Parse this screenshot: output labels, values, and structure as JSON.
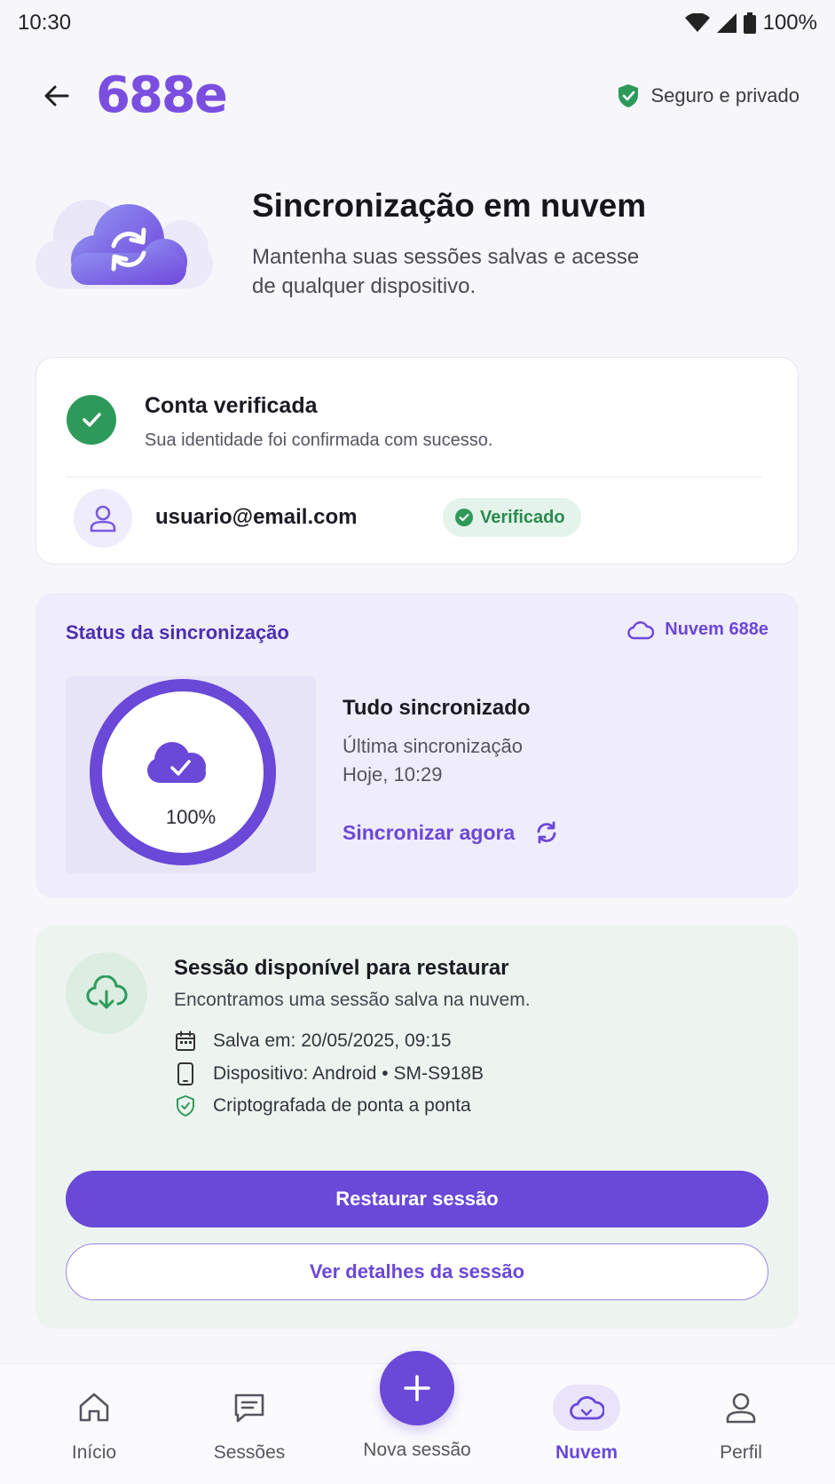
{
  "status_bar": {
    "time": "10:30",
    "battery": "100%"
  },
  "header": {
    "logo": "688e",
    "secure_label": "Seguro e privado"
  },
  "hero": {
    "title": "Sincronização em nuvem",
    "subtitle": "Mantenha suas sessões salvas e acesse de qualquer dispositivo."
  },
  "account": {
    "title": "Conta verificada",
    "subtitle": "Sua identidade foi confirmada com sucesso.",
    "email": "usuario@email.com",
    "badge": "Verificado"
  },
  "sync": {
    "section_label": "Status da sincronização",
    "cloud_label": "Nuvem 688e",
    "progress_percent": 100,
    "progress_label": "100%",
    "state": "Tudo sincronizado",
    "last_sync_label": "Última sincronização",
    "last_sync_time": "Hoje, 10:29",
    "sync_now_label": "Sincronizar agora"
  },
  "restore": {
    "title": "Sessão disponível para restaurar",
    "subtitle": "Encontramos uma sessão salva na nuvem.",
    "details": [
      {
        "icon": "calendar-icon",
        "text": "Salva em: 20/05/2025, 09:15"
      },
      {
        "icon": "phone-icon",
        "text": "Dispositivo: Android • SM-S918B"
      },
      {
        "icon": "shield-check-icon",
        "text": "Criptografada de ponta a ponta"
      }
    ],
    "primary_button": "Restaurar sessão",
    "secondary_button": "Ver detalhes da sessão"
  },
  "bottom_nav": {
    "items": [
      {
        "label": "Início",
        "icon": "home-icon",
        "active": false
      },
      {
        "label": "Sessões",
        "icon": "chat-icon",
        "active": false
      },
      {
        "label": "Nova sessão",
        "icon": "plus-icon",
        "active": false
      },
      {
        "label": "Nuvem",
        "icon": "cloud-icon",
        "active": true
      },
      {
        "label": "Perfil",
        "icon": "person-icon",
        "active": false
      }
    ]
  },
  "colors": {
    "accent": "#6a48d8",
    "success": "#2e9a5a",
    "sync_card_bg": "#efecfb",
    "restore_card_bg": "#edf4ef"
  }
}
